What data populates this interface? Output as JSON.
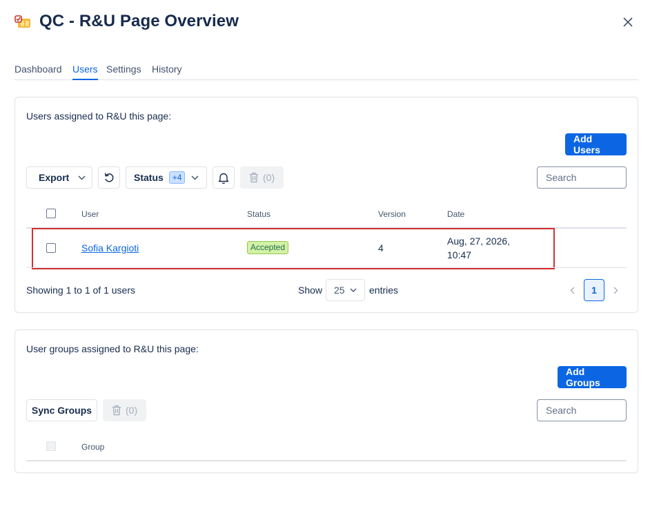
{
  "header": {
    "title": "QC - R&U Page Overview",
    "app_icon": "page-overview-icon",
    "close_icon": "close-icon"
  },
  "tabs": [
    {
      "label": "Dashboard",
      "active": false
    },
    {
      "label": "Users",
      "active": true
    },
    {
      "label": "Settings",
      "active": false
    },
    {
      "label": "History",
      "active": false
    }
  ],
  "users_panel": {
    "label": "Users assigned to R&U this page:",
    "add_button": "Add Users",
    "toolbar": {
      "export_label": "Export",
      "status_label": "Status",
      "status_badge": "+4",
      "delete_count": "(0)"
    },
    "search_placeholder": "Search",
    "columns": [
      "User",
      "Status",
      "Version",
      "Date"
    ],
    "rows": [
      {
        "user": "Sofia Kargioti",
        "status": "Accepted",
        "version": "4",
        "date_line1": "Aug, 27, 2026,",
        "date_line2": "10:47"
      }
    ],
    "footer": {
      "showing": "Showing 1 to 1 of 1 users",
      "show_label": "Show",
      "page_size": "25",
      "entries_label": "entries",
      "current_page": "1"
    }
  },
  "groups_panel": {
    "label": "User groups assigned to R&U this page:",
    "add_button": "Add Groups",
    "sync_button": "Sync Groups",
    "delete_count": "(0)",
    "search_placeholder": "Search",
    "columns": [
      "Group"
    ]
  },
  "colors": {
    "accent": "#0c66e4",
    "accepted_bg": "#d3f1a7",
    "highlight": "#d32f2f"
  }
}
